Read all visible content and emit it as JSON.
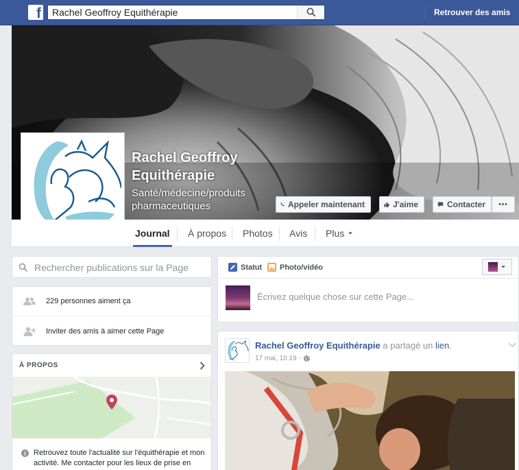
{
  "topbar": {
    "logo": "f",
    "search_value": "Rachel Geoffroy Equithérapie",
    "find_friends": "Retrouver des amis",
    "brand_color": "#3b5998"
  },
  "page": {
    "name": "Rachel Geoffroy Equithérapie",
    "category": "Santé/médecine/produits pharmaceutiques"
  },
  "actions": {
    "call": "Appeler maintenant",
    "like": "J'aime",
    "contact": "Contacter",
    "more": "•••"
  },
  "tabs": [
    "Journal",
    "À propos",
    "Photos",
    "Avis",
    "Plus"
  ],
  "left": {
    "search_placeholder": "Rechercher publications sur la Page",
    "likes": "229 personnes aiment ça",
    "invite": "Inviter des amis à aimer cette Page",
    "about_heading": "À PROPOS",
    "about_text": "Retrouvez toute l'actualité sur l'équithérapie et mon activité. Me contacter pour les lieux de prise en charge."
  },
  "composer": {
    "status": "Statut",
    "photo_video": "Photo/vidéo",
    "placeholder": "Écrivez quelque chose sur cette Page..."
  },
  "post": {
    "author": "Rachel Geoffroy Equithérapie",
    "action": "a partagé un",
    "link_word": "lien",
    "period": ".",
    "time": "17 mai, 10:19 ·"
  },
  "icons": [
    "search-icon",
    "phone-icon",
    "thumbs-up-icon",
    "message-icon",
    "people-icon",
    "add-friend-icon",
    "chevron-right-icon",
    "map-pin-icon",
    "info-icon",
    "edit-icon",
    "photo-icon",
    "globe-icon",
    "chevron-down-icon"
  ]
}
